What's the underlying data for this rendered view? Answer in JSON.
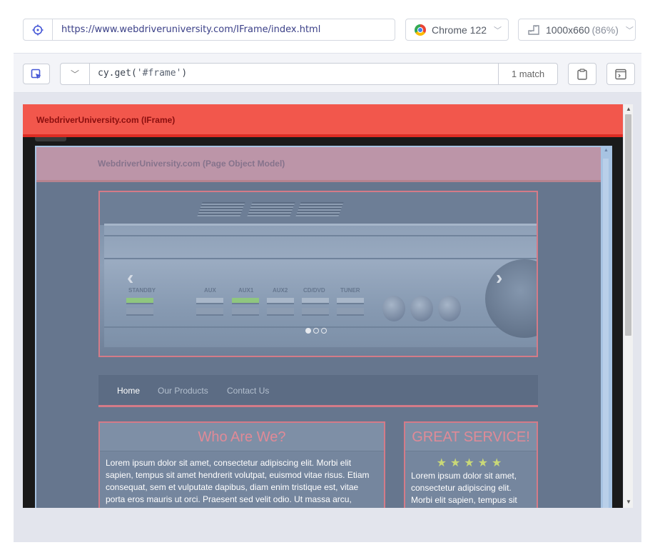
{
  "urlbar": {
    "url": "https://www.webdriveruniversity.com/IFrame/index.html",
    "browser": "Chrome 122",
    "viewport": "1000x660",
    "zoom": "(86%)"
  },
  "selector": {
    "fn": "cy.get(",
    "arg": "'#frame'",
    "close": ")",
    "matches": "1 match"
  },
  "outer_page": {
    "title": "WebdriverUniversity.com (IFrame)"
  },
  "inner_page": {
    "title": "WebdriverUniversity.com (Page Object Model)",
    "carousel": {
      "labels": [
        "STANDBY",
        "AUX",
        "AUX1",
        "AUX2",
        "CD/DVD",
        "TUNER"
      ],
      "prev": "‹",
      "next": "›"
    },
    "nav": [
      "Home",
      "Our Products",
      "Contact Us"
    ],
    "who": {
      "title": "Who Are We?",
      "text": "Lorem ipsum dolor sit amet, consectetur adipiscing elit. Morbi elit sapien, tempus sit amet hendrerit volutpat, euismod vitae risus. Etiam consequat, sem et vulputate dapibus, diam enim tristique est, vitae porta eros mauris ut orci. Praesent sed velit odio. Ut massa arcu,"
    },
    "service": {
      "title": "GREAT SERVICE!",
      "stars": "★★★★★",
      "text": "Lorem ipsum dolor sit amet, consectetur adipiscing elit. Morbi elit sapien, tempus sit"
    }
  }
}
